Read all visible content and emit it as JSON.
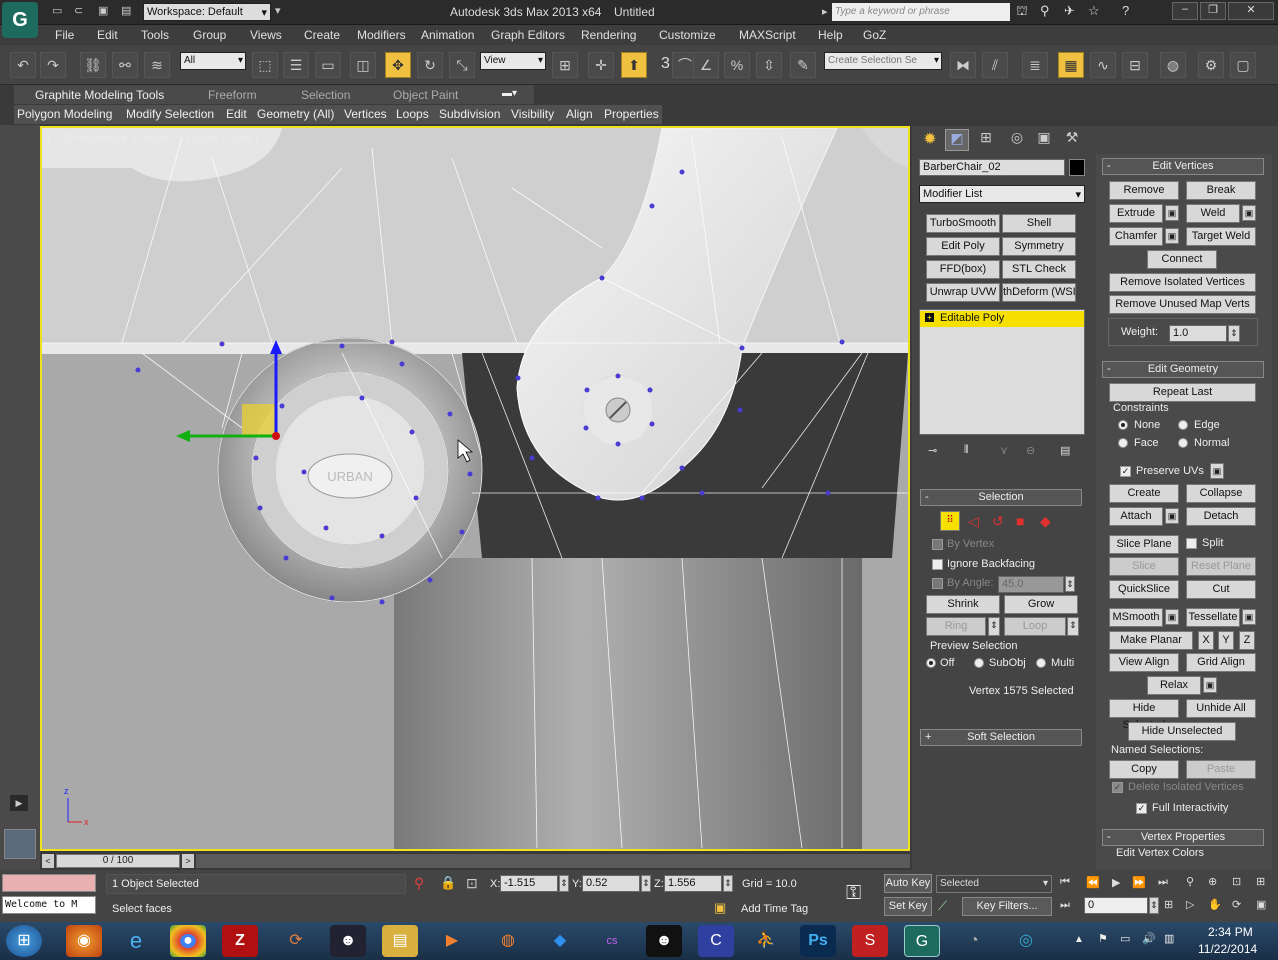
{
  "app": {
    "title": "Autodesk 3ds Max  2013 x64",
    "doc": "Untitled",
    "workspace": "Workspace: Default",
    "search_placeholder": "Type a keyword or phrase"
  },
  "menu": [
    "File",
    "Edit",
    "Tools",
    "Group",
    "Views",
    "Create",
    "Modifiers",
    "Animation",
    "Graph Editors",
    "Rendering",
    "Customize",
    "MAXScript",
    "Help",
    "GoZ"
  ],
  "toolbar": {
    "filter": "All",
    "refcoord": "View",
    "selset": "Create Selection Se",
    "snap_num": "3"
  },
  "ribbon": {
    "tabs": [
      "Graphite Modeling Tools",
      "Freeform",
      "Selection",
      "Object Paint"
    ],
    "sections": [
      "Polygon Modeling",
      "Modify Selection",
      "Edit",
      "Geometry (All)",
      "Vertices",
      "Loops",
      "Subdivision",
      "Visibility",
      "Align",
      "Properties"
    ]
  },
  "viewport": {
    "label": "[ + ][Perspective ][Shaded + Edged Faces ]",
    "axis_z": "z",
    "axis_x": "x",
    "plate_text": "URBAN"
  },
  "modpanel": {
    "object_name": "BarberChair_02",
    "modifier_list": "Modifier List",
    "buttons": [
      "TurboSmooth",
      "Shell",
      "Edit Poly",
      "Symmetry",
      "FFD(box)",
      "STL Check",
      "Unwrap UVW",
      "thDeform (WSI"
    ],
    "stack_item": "Editable Poly"
  },
  "selection": {
    "title": "Selection",
    "by_vertex": "By Vertex",
    "ignore_backfacing": "Ignore Backfacing",
    "by_angle": "By Angle:",
    "angle_value": "45.0",
    "shrink": "Shrink",
    "grow": "Grow",
    "ring": "Ring",
    "loop": "Loop",
    "preview": "Preview Selection",
    "off": "Off",
    "subobj": "SubObj",
    "multi": "Multi",
    "status": "Vertex 1575 Selected",
    "soft": "Soft Selection"
  },
  "edit_vertices": {
    "title": "Edit Vertices",
    "remove": "Remove",
    "break": "Break",
    "extrude": "Extrude",
    "weld": "Weld",
    "chamfer": "Chamfer",
    "target_weld": "Target Weld",
    "connect": "Connect",
    "remove_isolated": "Remove Isolated Vertices",
    "remove_unused": "Remove Unused Map Verts",
    "weight_label": "Weight:",
    "weight_value": "1.0"
  },
  "edit_geometry": {
    "title": "Edit Geometry",
    "repeat": "Repeat Last",
    "constraints": "Constraints",
    "none": "None",
    "edge": "Edge",
    "face": "Face",
    "normal": "Normal",
    "preserve_uvs": "Preserve UVs",
    "create": "Create",
    "collapse": "Collapse",
    "attach": "Attach",
    "detach": "Detach",
    "slice_plane": "Slice Plane",
    "split": "Split",
    "slice": "Slice",
    "reset_plane": "Reset Plane",
    "quickslice": "QuickSlice",
    "cut": "Cut",
    "msmooth": "MSmooth",
    "tessellate": "Tessellate",
    "make_planar": "Make Planar",
    "x": "X",
    "y": "Y",
    "z": "Z",
    "view_align": "View Align",
    "grid_align": "Grid Align",
    "relax": "Relax",
    "hide_selected": "Hide Selected",
    "unhide_all": "Unhide All",
    "hide_unselected": "Hide Unselected",
    "named_sel": "Named Selections:",
    "copy": "Copy",
    "paste": "Paste",
    "delete_isolated": "Delete Isolated Vertices",
    "full_interactivity": "Full Interactivity",
    "vertex_props": "Vertex Properties",
    "edit_vertex_colors": "Edit Vertex Colors"
  },
  "status": {
    "timeline": "0 / 100",
    "selected": "1 Object Selected",
    "prompt": "Select faces",
    "listener": "Welcome to M",
    "x_label": "X:",
    "x": "-1.515",
    "y_label": "Y:",
    "y": "0.52",
    "z_label": "Z:",
    "z": "1.556",
    "grid": "Grid = 10.0",
    "add_time_tag": "Add Time Tag",
    "auto_key": "Auto Key",
    "set_key": "Set Key",
    "key_mode": "Selected",
    "key_filters": "Key Filters...",
    "frame": "0"
  },
  "taskbar": {
    "time": "2:34 PM",
    "date": "11/22/2014"
  },
  "colors": {
    "accent": "#f0c040",
    "viewport_border": "#f0e020",
    "stack_highlight": "#f5e000"
  }
}
